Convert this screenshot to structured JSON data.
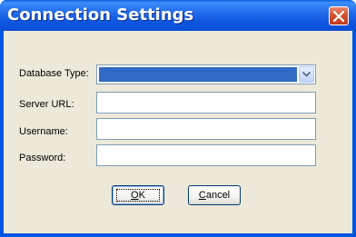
{
  "window": {
    "title": "Connection Settings",
    "close_icon": "close-x-icon"
  },
  "form": {
    "database_type": {
      "label": "Database Type:",
      "value": ""
    },
    "server_url": {
      "label": "Server URL:",
      "value": "",
      "placeholder": ""
    },
    "username": {
      "label": "Username:",
      "value": "",
      "placeholder": ""
    },
    "password": {
      "label": "Password:",
      "value": "",
      "placeholder": ""
    }
  },
  "buttons": {
    "ok_mnemonic": "O",
    "ok_rest": "K",
    "cancel_mnemonic": "C",
    "cancel_rest": "ancel"
  },
  "colors": {
    "titlebar": "#0054e3",
    "client_background": "#ece9d8",
    "selection": "#316ac5",
    "close_button": "#d6532f"
  }
}
